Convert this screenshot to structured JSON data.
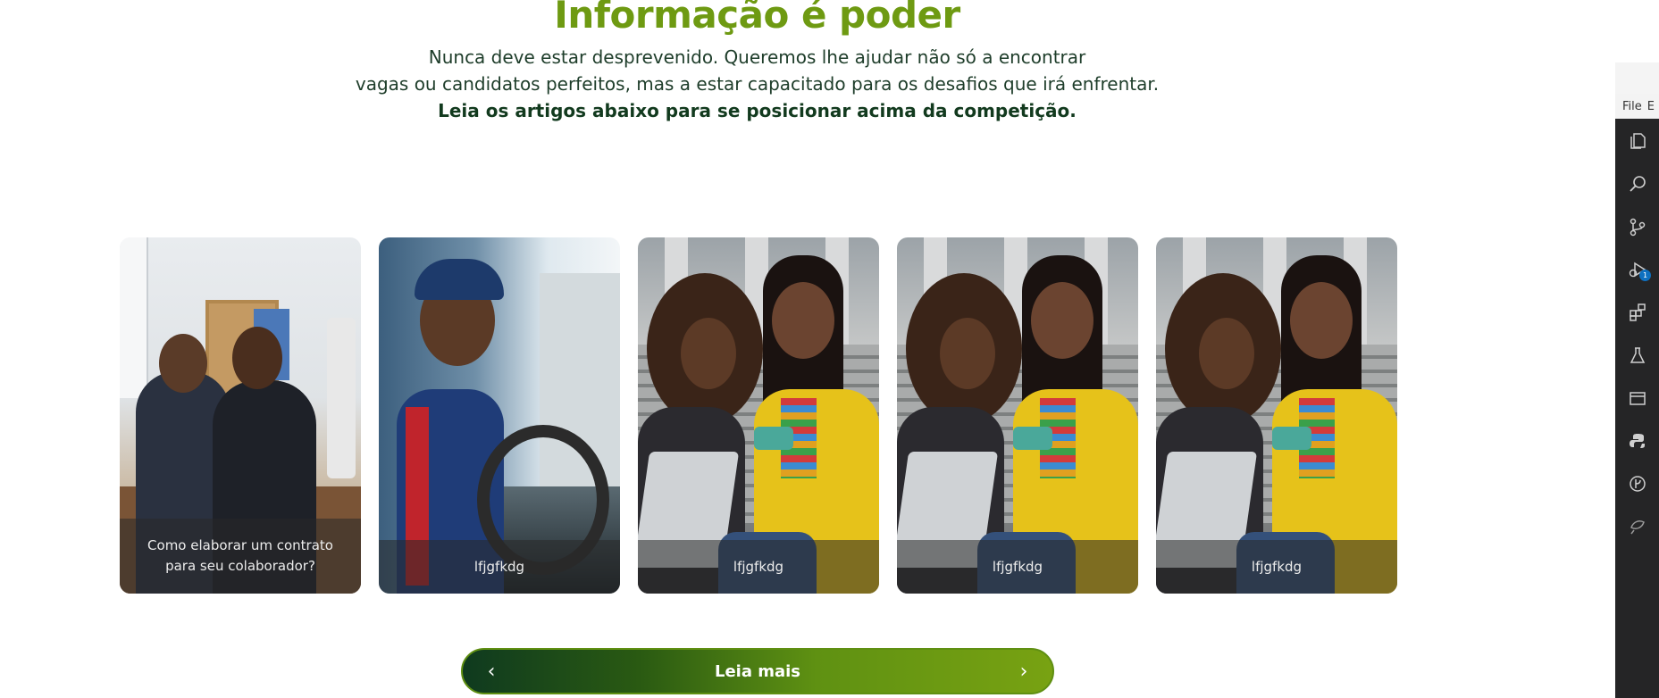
{
  "section": {
    "headline": "Informação é poder",
    "intro_line1": "Nunca deve estar desprevenido. Queremos lhe ajudar não só a encontrar",
    "intro_line2": "vagas ou candidatos perfeitos, mas a estar capacitado para os desafios que irá enfrentar.",
    "intro_line3": "Leia os artigos abaixo para se posicionar acima da competição."
  },
  "articles": [
    {
      "caption": "Como elaborar um contrato para seu colaborador?",
      "image": "office-meeting-photo"
    },
    {
      "caption": "lfjgfkdg",
      "image": "delivery-driver-photo"
    },
    {
      "caption": "lfjgfkdg",
      "image": "students-with-phone-photo"
    },
    {
      "caption": "lfjgfkdg",
      "image": "students-with-phone-photo"
    },
    {
      "caption": "lfjgfkdg",
      "image": "students-with-phone-photo"
    }
  ],
  "carousel_nav": {
    "label": "Leia mais",
    "prev_icon": "chevron-left-icon",
    "next_icon": "chevron-right-icon"
  },
  "editor": {
    "menu_file": "File",
    "menu_next_partial": "E",
    "activity_icons": [
      "explorer-icon",
      "search-icon",
      "source-control-icon",
      "run-debug-icon",
      "extensions-icon",
      "testing-icon",
      "remote-explorer-icon",
      "python-icon",
      "gitlens-icon",
      "docker-icon"
    ],
    "debug_badge": "1"
  },
  "colors": {
    "headline": "#6e9a12",
    "intro_text": "#1e3d2a",
    "nav_gradient_start": "#0f3a1f",
    "nav_gradient_end": "#78a212"
  }
}
